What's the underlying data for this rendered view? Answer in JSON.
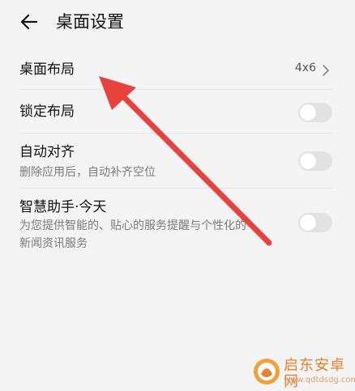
{
  "header": {
    "title": "桌面设置"
  },
  "items": [
    {
      "label": "桌面布局",
      "value": "4x6"
    },
    {
      "label": "锁定布局"
    },
    {
      "label": "自动对齐",
      "desc": "删除应用后，自动补齐空位"
    },
    {
      "label": "智慧助手·今天",
      "desc_line1": "为您提供智能的、贴心的服务提醒与个性化的",
      "desc_line2": "新闻资讯服务"
    }
  ],
  "watermark": {
    "name": "启东安卓网",
    "url": "www.qdtdsdg.com"
  },
  "colors": {
    "annotation_arrow": "#e8423f",
    "toggle_off": "#e2e2e2"
  }
}
